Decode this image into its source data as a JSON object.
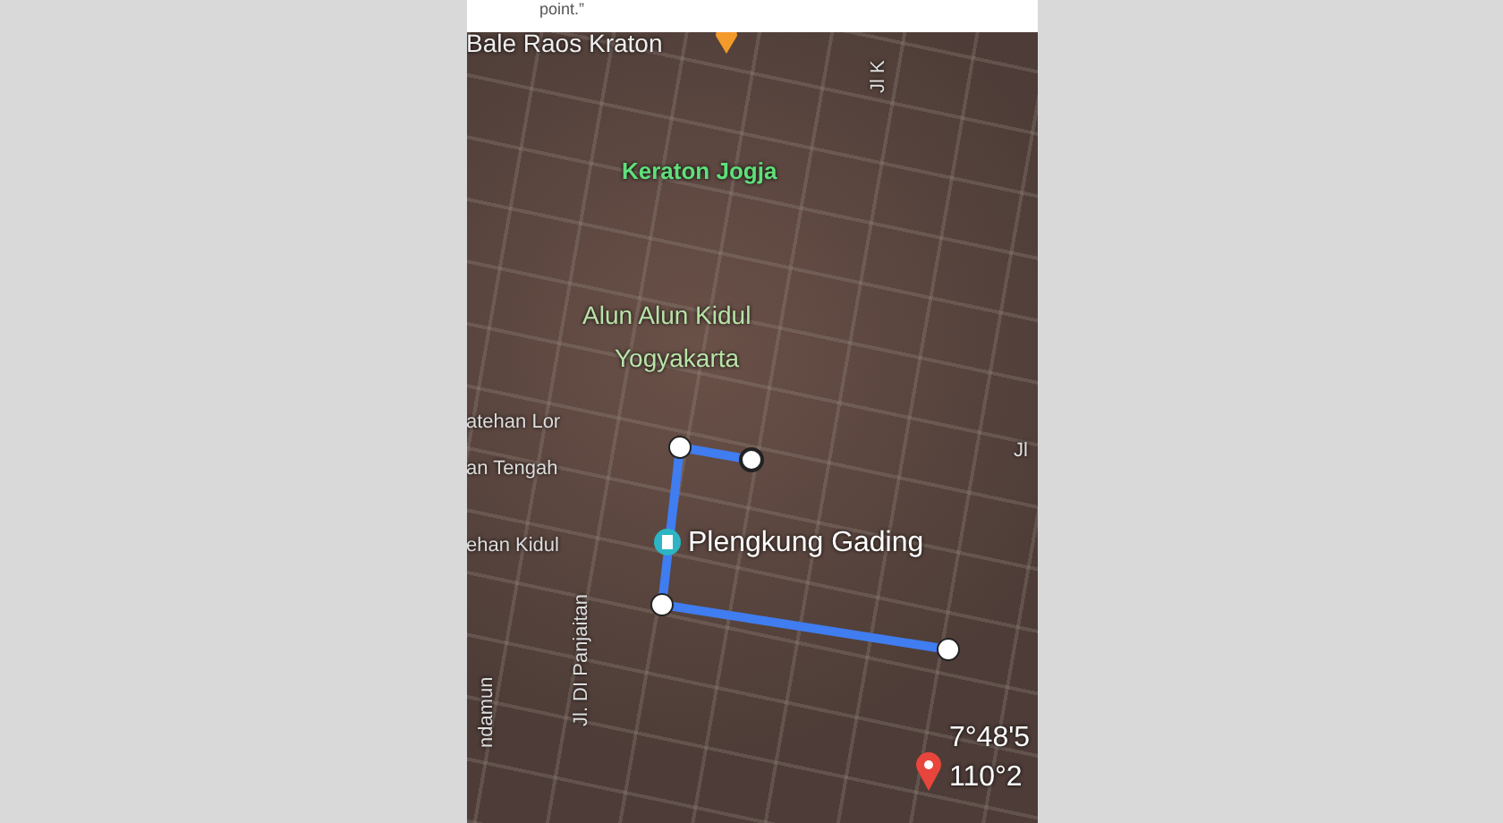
{
  "header": {
    "text": "point.”"
  },
  "map": {
    "labels": [
      {
        "text": "Bale Raos Kraton",
        "kind": "place"
      },
      {
        "text": "Jl K",
        "kind": "street-vertical"
      },
      {
        "text": "Keraton Jogja",
        "kind": "landmark"
      },
      {
        "text": "Alun Alun Kidul",
        "kind": "park"
      },
      {
        "text": "Yogyakarta",
        "kind": "park"
      },
      {
        "text": "atehan Lor",
        "kind": "street"
      },
      {
        "text": "an Tengah",
        "kind": "street"
      },
      {
        "text": "Jl",
        "kind": "street"
      },
      {
        "text": "ehan Kidul",
        "kind": "street"
      },
      {
        "text": "Plengkung Gading",
        "kind": "poi"
      },
      {
        "text": "Jl. DI Panjaitan",
        "kind": "street-vertical"
      },
      {
        "text": "ndamun",
        "kind": "street-vertical"
      }
    ],
    "coordinates": [
      "7°48'5",
      "110°2"
    ]
  }
}
